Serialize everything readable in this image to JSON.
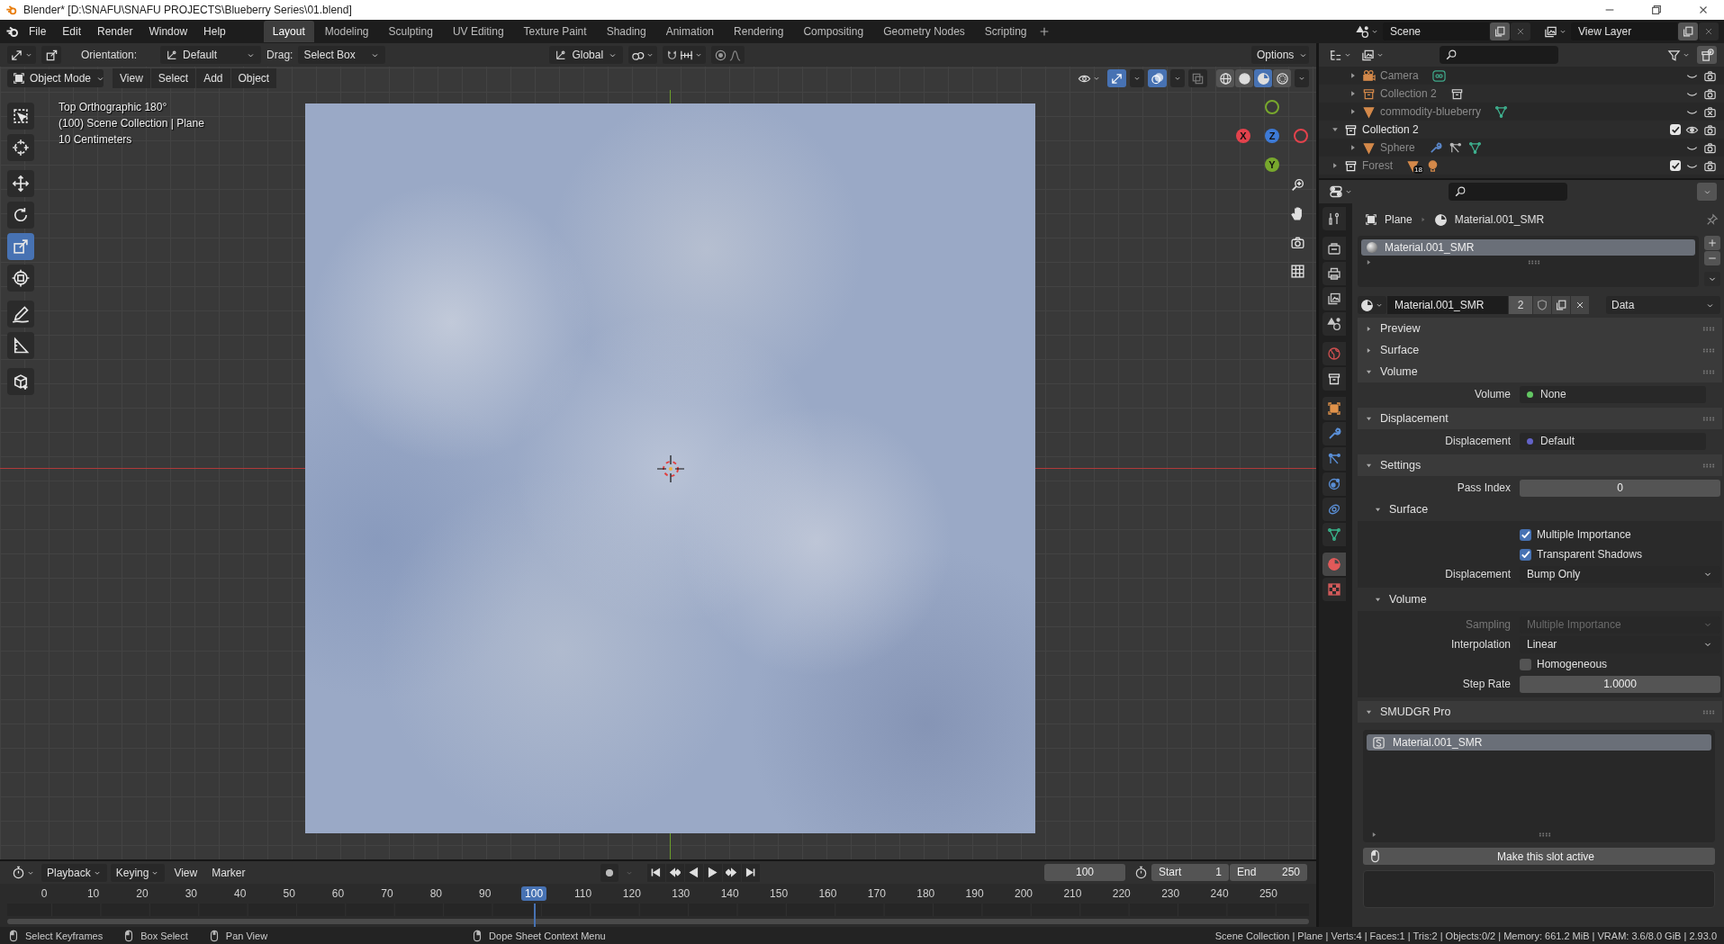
{
  "window": {
    "title": "Blender* [D:\\SNAFU\\SNAFU PROJECTS\\Blueberry Series\\01.blend]"
  },
  "menu": [
    "File",
    "Edit",
    "Render",
    "Window",
    "Help"
  ],
  "workspaces": [
    {
      "label": "Layout",
      "selected": true
    },
    {
      "label": "Modeling",
      "selected": false
    },
    {
      "label": "Sculpting",
      "selected": false
    },
    {
      "label": "UV Editing",
      "selected": false
    },
    {
      "label": "Texture Paint",
      "selected": false
    },
    {
      "label": "Shading",
      "selected": false
    },
    {
      "label": "Animation",
      "selected": false
    },
    {
      "label": "Rendering",
      "selected": false
    },
    {
      "label": "Compositing",
      "selected": false
    },
    {
      "label": "Geometry Nodes",
      "selected": false
    },
    {
      "label": "Scripting",
      "selected": false
    }
  ],
  "scene": "Scene",
  "view_layer": "View Layer",
  "tool_header": {
    "orientation_label": "Orientation:",
    "orientation": "Default",
    "drag_label": "Drag:",
    "drag": "Select Box",
    "transform_space": "Global",
    "options": "Options"
  },
  "viewport": {
    "mode": "Object Mode",
    "menus": [
      "View",
      "Select",
      "Add",
      "Object"
    ],
    "shading": [
      {
        "kind": "wireframe",
        "selected": false
      },
      {
        "kind": "solid",
        "selected": false
      },
      {
        "kind": "material",
        "selected": true
      },
      {
        "kind": "rendered",
        "selected": false
      }
    ],
    "info": [
      "Top Orthographic 180°",
      "(100) Scene Collection | Plane",
      "10 Centimeters"
    ],
    "axes": [
      {
        "label": "X",
        "color": "#e3424c"
      },
      {
        "label": "Y",
        "color": "#78a82d"
      },
      {
        "label": "Z",
        "color": "#3d7ad6"
      }
    ],
    "tool_groups": [
      {
        "tools": [
          {
            "kind": "select",
            "selected": false
          },
          {
            "kind": "cursor",
            "selected": false
          }
        ]
      },
      {
        "tools": [
          {
            "kind": "move",
            "selected": false
          },
          {
            "kind": "rotate",
            "selected": false
          },
          {
            "kind": "scale",
            "selected": true
          },
          {
            "kind": "transform",
            "selected": false
          }
        ]
      },
      {
        "tools": [
          {
            "kind": "annotate",
            "selected": false
          },
          {
            "kind": "measure",
            "selected": false
          }
        ]
      },
      {
        "tools": [
          {
            "kind": "add-cube",
            "selected": false
          }
        ]
      }
    ]
  },
  "outliner": {
    "items": [
      {
        "children": [
          {
            "name": "Camera",
            "kind": "camera",
            "expanded": false,
            "visible": false,
            "render": true,
            "extras": [
              {
                "kind": "camera-data"
              }
            ]
          },
          {
            "name": "Collection 2",
            "kind": "instance",
            "expanded": false,
            "visible": false,
            "render": true,
            "extras": [
              {
                "kind": "collection"
              }
            ]
          },
          {
            "name": "commodity-blueberry",
            "kind": "mesh",
            "expanded": false,
            "visible": false,
            "render": false,
            "extras": [
              {
                "kind": "mesh-data"
              }
            ]
          }
        ]
      },
      {
        "name": "Collection 2",
        "kind": "collection",
        "expanded": true,
        "checked": true,
        "visible": true,
        "render": true,
        "children": [
          {
            "name": "Sphere",
            "kind": "mesh",
            "expanded": false,
            "visible": false,
            "render": true,
            "extras": [
              {
                "kind": "modifier"
              },
              {
                "kind": "particles"
              },
              {
                "kind": "mesh-data"
              }
            ]
          }
        ]
      },
      {
        "name": "Forest",
        "kind": "collection",
        "expanded": false,
        "checked": true,
        "visible": false,
        "render": true,
        "extras": [
          {
            "kind": "mesh",
            "count": "18"
          },
          {
            "kind": "light"
          }
        ]
      }
    ]
  },
  "properties": {
    "tabs": [
      {
        "kind": "tool",
        "selected": false
      },
      {
        "kind": "render",
        "selected": false
      },
      {
        "kind": "output",
        "selected": false
      },
      {
        "kind": "view-layer",
        "selected": false
      },
      {
        "kind": "scene",
        "selected": false
      },
      {
        "kind": "world",
        "selected": false
      },
      {
        "kind": "collection",
        "selected": false
      },
      {
        "kind": "object",
        "selected": false
      },
      {
        "kind": "modifier",
        "selected": false
      },
      {
        "kind": "particles",
        "selected": false
      },
      {
        "kind": "physics",
        "selected": false
      },
      {
        "kind": "constraints",
        "selected": false
      },
      {
        "kind": "mesh-data",
        "selected": false
      },
      {
        "kind": "material",
        "selected": true
      },
      {
        "kind": "texture",
        "selected": false
      }
    ],
    "breadcrumb": [
      "Plane",
      "Material.001_SMR"
    ],
    "slots": [
      {
        "label": "Material.001_SMR",
        "selected": true
      }
    ],
    "material": {
      "name": "Material.001_SMR",
      "users": "2",
      "link": "Data"
    },
    "panels": [
      {
        "title": "Preview",
        "expanded": false
      },
      {
        "title": "Surface",
        "expanded": false
      },
      {
        "title": "Volume",
        "expanded": true,
        "rows": [
          {
            "kind": "socket",
            "label": "Volume",
            "value": "None",
            "color": "#63c763"
          }
        ]
      },
      {
        "title": "Displacement",
        "expanded": true,
        "rows": [
          {
            "kind": "socket",
            "label": "Displacement",
            "value": "Default",
            "color": "#6363c7"
          }
        ]
      },
      {
        "title": "Settings",
        "expanded": true,
        "rows": [
          {
            "kind": "number",
            "label": "Pass Index",
            "value": "0"
          }
        ],
        "subpanels": [
          {
            "title": "Surface",
            "expanded": true,
            "rows": [
              {
                "kind": "checkbox",
                "label": "Multiple Importance",
                "checked": true
              },
              {
                "kind": "checkbox",
                "label": "Transparent Shadows",
                "checked": true
              },
              {
                "kind": "dropdown",
                "label": "Displacement",
                "value": "Bump Only",
                "disabled": false
              }
            ]
          },
          {
            "title": "Volume",
            "expanded": true,
            "rows": [
              {
                "kind": "dropdown",
                "label": "Sampling",
                "value": "Multiple Importance",
                "disabled": true
              },
              {
                "kind": "dropdown",
                "label": "Interpolation",
                "value": "Linear",
                "disabled": false
              },
              {
                "kind": "checkbox",
                "label": "Homogeneous",
                "checked": false
              },
              {
                "kind": "number",
                "label": "Step Rate",
                "value": "1.0000"
              }
            ]
          }
        ]
      },
      {
        "title": "SMUDGR Pro",
        "expanded": true,
        "list": [
          {
            "label": "Material.001_SMR",
            "selected": true
          }
        ],
        "button": "Make this slot active"
      }
    ]
  },
  "timeline": {
    "menus": [
      {
        "label": "Playback",
        "dropdown": true
      },
      {
        "label": "Keying",
        "dropdown": true
      },
      {
        "label": "View",
        "dropdown": false
      },
      {
        "label": "Marker",
        "dropdown": false
      }
    ],
    "current_frame": "100",
    "start_label": "Start",
    "start": "1",
    "end_label": "End",
    "end": "250",
    "ruler": [
      {
        "label": "0",
        "selected": false
      },
      {
        "label": "10",
        "selected": false
      },
      {
        "label": "20",
        "selected": false
      },
      {
        "label": "30",
        "selected": false
      },
      {
        "label": "40",
        "selected": false
      },
      {
        "label": "50",
        "selected": false
      },
      {
        "label": "60",
        "selected": false
      },
      {
        "label": "70",
        "selected": false
      },
      {
        "label": "80",
        "selected": false
      },
      {
        "label": "90",
        "selected": false
      },
      {
        "label": "100",
        "selected": true
      },
      {
        "label": "110",
        "selected": false
      },
      {
        "label": "120",
        "selected": false
      },
      {
        "label": "130",
        "selected": false
      },
      {
        "label": "140",
        "selected": false
      },
      {
        "label": "150",
        "selected": false
      },
      {
        "label": "160",
        "selected": false
      },
      {
        "label": "170",
        "selected": false
      },
      {
        "label": "180",
        "selected": false
      },
      {
        "label": "190",
        "selected": false
      },
      {
        "label": "200",
        "selected": false
      },
      {
        "label": "210",
        "selected": false
      },
      {
        "label": "220",
        "selected": false
      },
      {
        "label": "230",
        "selected": false
      },
      {
        "label": "240",
        "selected": false
      },
      {
        "label": "250",
        "selected": false
      }
    ]
  },
  "status": {
    "hints": [
      {
        "kind": "left-click",
        "label": "Select Keyframes"
      },
      {
        "kind": "left-drag",
        "label": "Box Select"
      },
      {
        "kind": "middle-click",
        "label": "Pan View"
      },
      {
        "kind": "right-click",
        "label": "Dope Sheet Context Menu"
      }
    ],
    "stats": "Scene Collection | Plane | Verts:4 | Faces:1 | Tris:2 | Objects:0/2 | Memory: 661.2 MiB | VRAM: 3.6/8.0 GiB | 2.93.0"
  }
}
